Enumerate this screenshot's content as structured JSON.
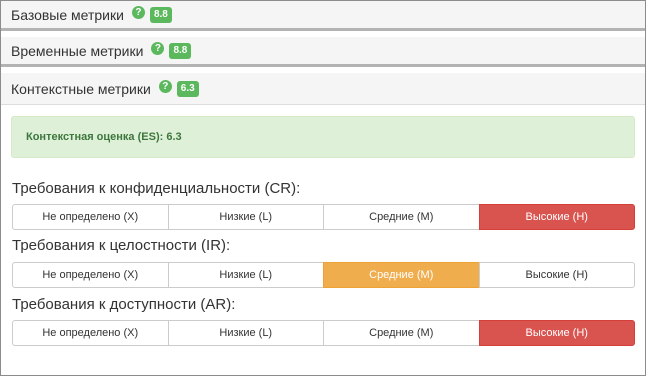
{
  "sections": [
    {
      "title": "Базовые метрики",
      "help": "?",
      "score": "8.8"
    },
    {
      "title": "Временные метрики",
      "help": "?",
      "score": "8.8"
    },
    {
      "title": "Контекстные метрики",
      "help": "?",
      "score": "6.3"
    }
  ],
  "alert": {
    "text": "Контекстная оценка (ES): 6.3"
  },
  "requirements": [
    {
      "label": "Требования к конфиденциальности (CR):",
      "options": [
        "Не определено (X)",
        "Низкие (L)",
        "Средние (M)",
        "Высокие (H)"
      ],
      "selected": "Высокие (H)"
    },
    {
      "label": "Требования к целостности (IR):",
      "options": [
        "Не определено (X)",
        "Низкие (L)",
        "Средние (M)",
        "Высокие (H)"
      ],
      "selected": "Средние (M)"
    },
    {
      "label": "Требования к доступности (AR):",
      "options": [
        "Не определено (X)",
        "Низкие (L)",
        "Средние (M)",
        "Высокие (H)"
      ],
      "selected": "Высокие (H)"
    }
  ],
  "colors": {
    "success": "#5cb85c",
    "danger": "#d9534f",
    "warning": "#f0ad4e",
    "alert_bg": "#dff0d8"
  }
}
